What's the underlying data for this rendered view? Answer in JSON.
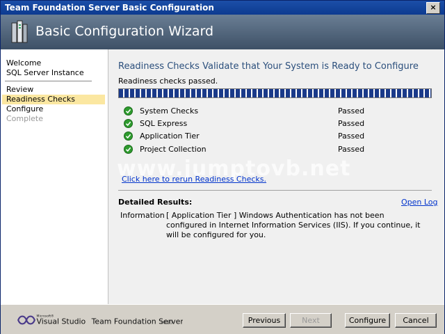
{
  "window": {
    "title": "Team Foundation Server Basic Configuration",
    "close_label": "×"
  },
  "header": {
    "title": "Basic Configuration Wizard"
  },
  "sidebar": {
    "items": [
      {
        "label": "Welcome"
      },
      {
        "label": "SQL Server Instance"
      },
      {
        "label": "Review"
      },
      {
        "label": "Readiness Checks"
      },
      {
        "label": "Configure"
      },
      {
        "label": "Complete"
      }
    ]
  },
  "main": {
    "heading": "Readiness Checks Validate that Your System is Ready to Configure",
    "subtext": "Readiness checks passed.",
    "progress": {
      "percent": 100
    },
    "checks": [
      {
        "name": "System Checks",
        "status": "Passed"
      },
      {
        "name": "SQL Express",
        "status": "Passed"
      },
      {
        "name": "Application Tier",
        "status": "Passed"
      },
      {
        "name": "Project Collection",
        "status": "Passed"
      }
    ],
    "rerun_link": "Click here to rerun Readiness Checks.",
    "watermark": "www.jumptovb.net",
    "details": {
      "title": "Detailed Results:",
      "open_log": "Open Log",
      "info_label": "Information",
      "info_text": "[ Application Tier ] Windows Authentication has not been configured in Internet Information Services (IIS). If you continue, it will be configured for you."
    }
  },
  "footer": {
    "brand_small": "Microsoft®",
    "brand_vs": "Visual Studio",
    "brand_rest": "Team Foundation Server",
    "brand_year": "2010",
    "buttons": {
      "previous": "Previous",
      "next": "Next",
      "configure": "Configure",
      "cancel": "Cancel"
    }
  },
  "colors": {
    "check_ok": "#2e9b2e",
    "link": "#0033cc",
    "selected_bg": "#fbe7a1",
    "heading": "#2b4f7c"
  }
}
